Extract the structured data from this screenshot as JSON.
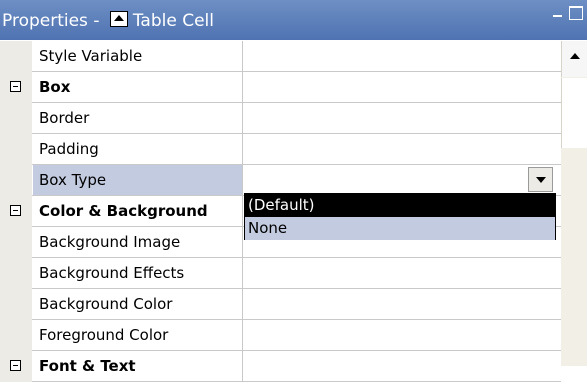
{
  "window": {
    "title_prefix": "Properties - ",
    "title_label": "Table Cell",
    "title_icon": "table-cell-icon"
  },
  "properties": [
    {
      "name": "Style Variable",
      "kind": "property"
    },
    {
      "name": "Box",
      "kind": "category"
    },
    {
      "name": "Border",
      "kind": "property"
    },
    {
      "name": "Padding",
      "kind": "property"
    },
    {
      "name": "Box Type",
      "kind": "property",
      "selected": true
    },
    {
      "name": "Color & Background",
      "kind": "category"
    },
    {
      "name": "Background Image",
      "kind": "property"
    },
    {
      "name": "Background Effects",
      "kind": "property"
    },
    {
      "name": "Background Color",
      "kind": "property"
    },
    {
      "name": "Foreground Color",
      "kind": "property"
    },
    {
      "name": "Font & Text",
      "kind": "category"
    }
  ],
  "dropdown": {
    "options": [
      "(Default)",
      "None"
    ],
    "highlighted_index": 0
  },
  "colors": {
    "titlebar": "#4f73b2",
    "selected_row": "#c3cbe0",
    "gutter": "#ecebe6"
  }
}
